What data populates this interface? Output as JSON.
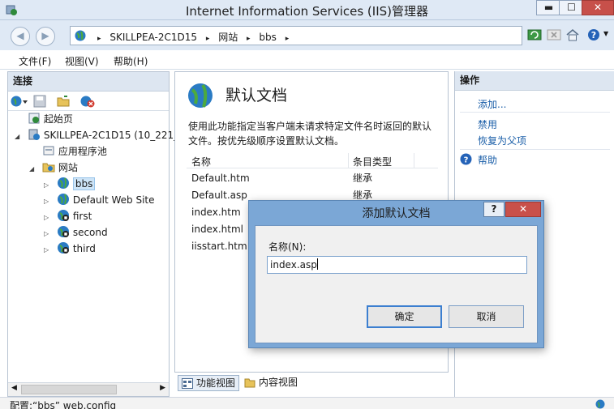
{
  "window": {
    "title": "Internet Information Services (IIS)管理器",
    "min_glyph": "▬",
    "max_glyph": "☐",
    "close_glyph": "✕"
  },
  "address": {
    "crumbs": [
      "SKILLPEA-2C1D15",
      "网站",
      "bbs"
    ],
    "sep": "▸"
  },
  "menu": {
    "file": "文件(F)",
    "view": "视图(V)",
    "help": "帮助(H)"
  },
  "connections": {
    "header": "连接",
    "tree": [
      {
        "label": "起始页",
        "icon": "start-page-icon"
      },
      {
        "label": "SKILLPEA-2C1D15 (10_221_",
        "icon": "server-icon"
      },
      {
        "label": "应用程序池",
        "icon": "app-pools-icon"
      },
      {
        "label": "网站",
        "icon": "sites-folder-icon"
      },
      {
        "label": "bbs",
        "icon": "site-globe-icon"
      },
      {
        "label": "Default Web Site",
        "icon": "site-globe-icon"
      },
      {
        "label": "first",
        "icon": "site-globe-icon"
      },
      {
        "label": "second",
        "icon": "site-globe-icon"
      },
      {
        "label": "third",
        "icon": "site-globe-icon"
      }
    ]
  },
  "feature": {
    "title": "默认文档",
    "description": "使用此功能指定当客户端未请求特定文件名时返回的默认文件。按优先级顺序设置默认文档。",
    "columns": {
      "name": "名称",
      "type": "条目类型"
    },
    "rows": [
      {
        "name": "Default.htm",
        "type": "继承"
      },
      {
        "name": "Default.asp",
        "type": "继承"
      },
      {
        "name": "index.htm",
        "type": ""
      },
      {
        "name": "index.html",
        "type": ""
      },
      {
        "name": "iisstart.htm",
        "type": ""
      }
    ]
  },
  "view_tabs": {
    "features": "功能视图",
    "content": "内容视图"
  },
  "actions": {
    "header": "操作",
    "add": "添加...",
    "disable": "禁用",
    "revert": "恢复为父项",
    "help": "帮助"
  },
  "status": {
    "text": "配置:“bbs” web.config"
  },
  "dialog": {
    "title": "添加默认文档",
    "help_glyph": "?",
    "close_glyph": "✕",
    "name_label": "名称(N):",
    "name_value": "index.asp",
    "ok": "确定",
    "cancel": "取消"
  },
  "colors": {
    "accent": "#1a5ea8",
    "dialog_frame": "#7ba7d6",
    "close_red": "#c9504a"
  }
}
